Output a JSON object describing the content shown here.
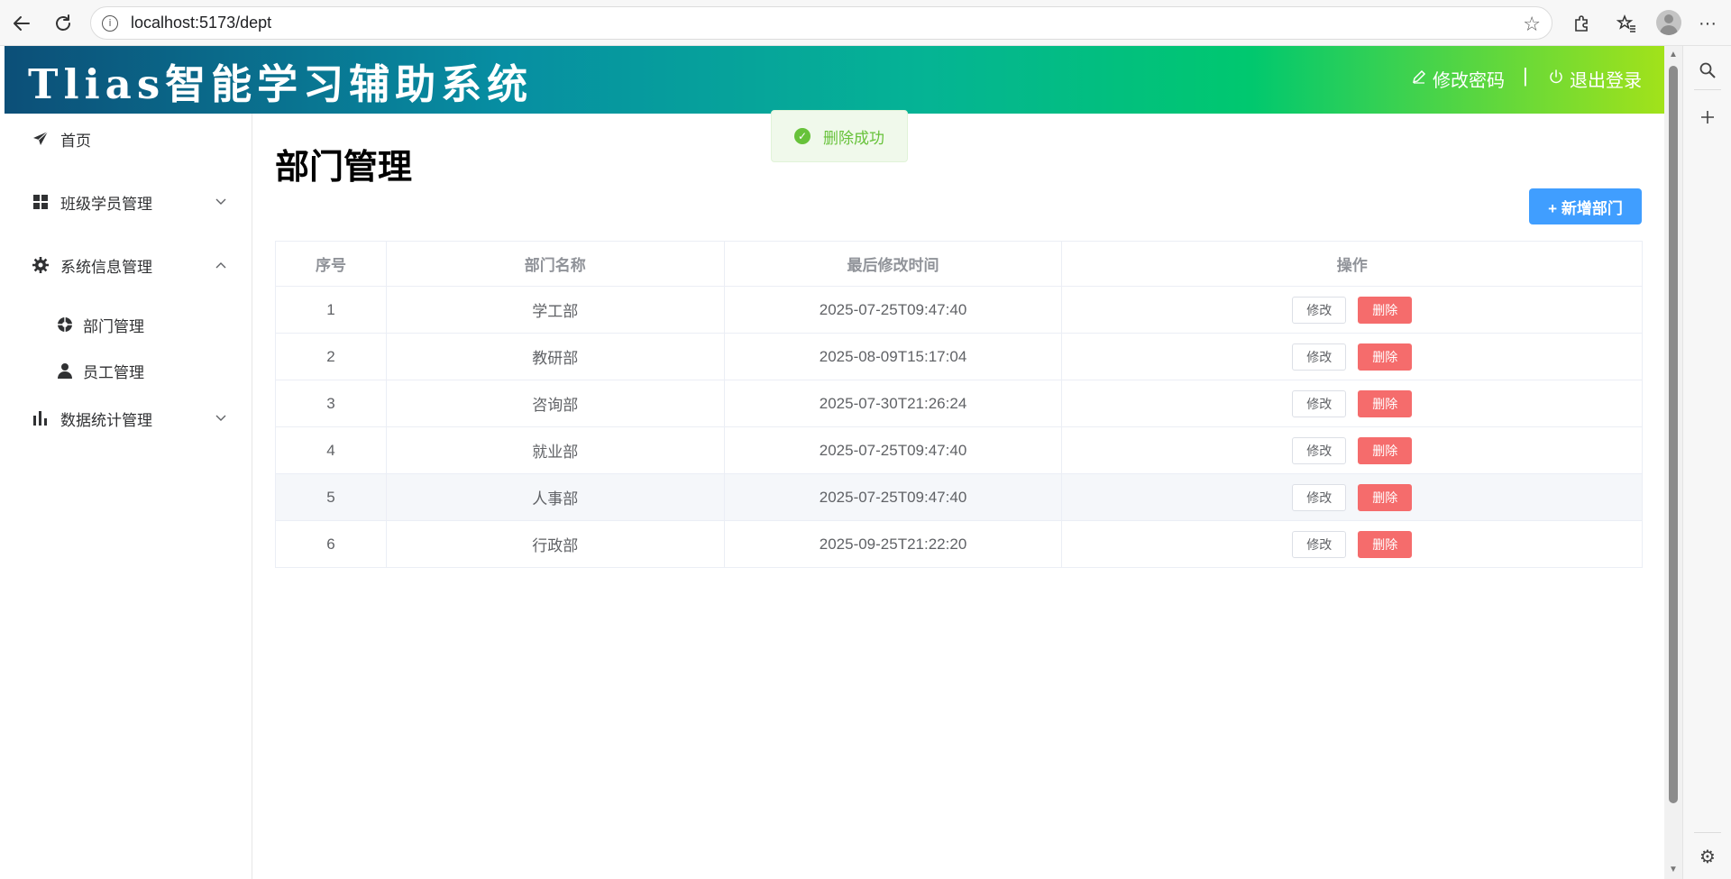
{
  "browser": {
    "url": "localhost:5173/dept",
    "info_icon": "i"
  },
  "header": {
    "title": "Tlias智能学习辅助系统",
    "change_password": "修改密码",
    "separator": "|",
    "logout": "退出登录",
    "gradient_colors": [
      "#0c4f78",
      "#078ea2",
      "#00c86f",
      "#a2e21a"
    ]
  },
  "toast": {
    "message": "删除成功",
    "icon": "check-circle-icon",
    "color": "#67c23a"
  },
  "sidebar": {
    "items": [
      {
        "label": "首页",
        "icon": "paper-plane-icon"
      },
      {
        "label": "班级学员管理",
        "icon": "grid-icon",
        "arrow": "⌄"
      },
      {
        "label": "系统信息管理",
        "icon": "gear-icon",
        "arrow": "⌃"
      },
      {
        "label": "部门管理",
        "icon": "aperture-icon"
      },
      {
        "label": "员工管理",
        "icon": "user-icon"
      },
      {
        "label": "数据统计管理",
        "icon": "bar-chart-icon",
        "arrow": "⌄"
      }
    ]
  },
  "main": {
    "page_title": "部门管理",
    "add_button": "+ 新增部门",
    "table": {
      "headers": [
        "序号",
        "部门名称",
        "最后修改时间",
        "操作"
      ],
      "edit_label": "修改",
      "delete_label": "删除",
      "rows": [
        {
          "index": "1",
          "name": "学工部",
          "updated": "2025-07-25T09:47:40"
        },
        {
          "index": "2",
          "name": "教研部",
          "updated": "2025-08-09T15:17:04"
        },
        {
          "index": "3",
          "name": "咨询部",
          "updated": "2025-07-30T21:26:24"
        },
        {
          "index": "4",
          "name": "就业部",
          "updated": "2025-07-25T09:47:40"
        },
        {
          "index": "5",
          "name": "人事部",
          "updated": "2025-07-25T09:47:40"
        },
        {
          "index": "6",
          "name": "行政部",
          "updated": "2025-09-25T21:22:20"
        }
      ]
    }
  }
}
